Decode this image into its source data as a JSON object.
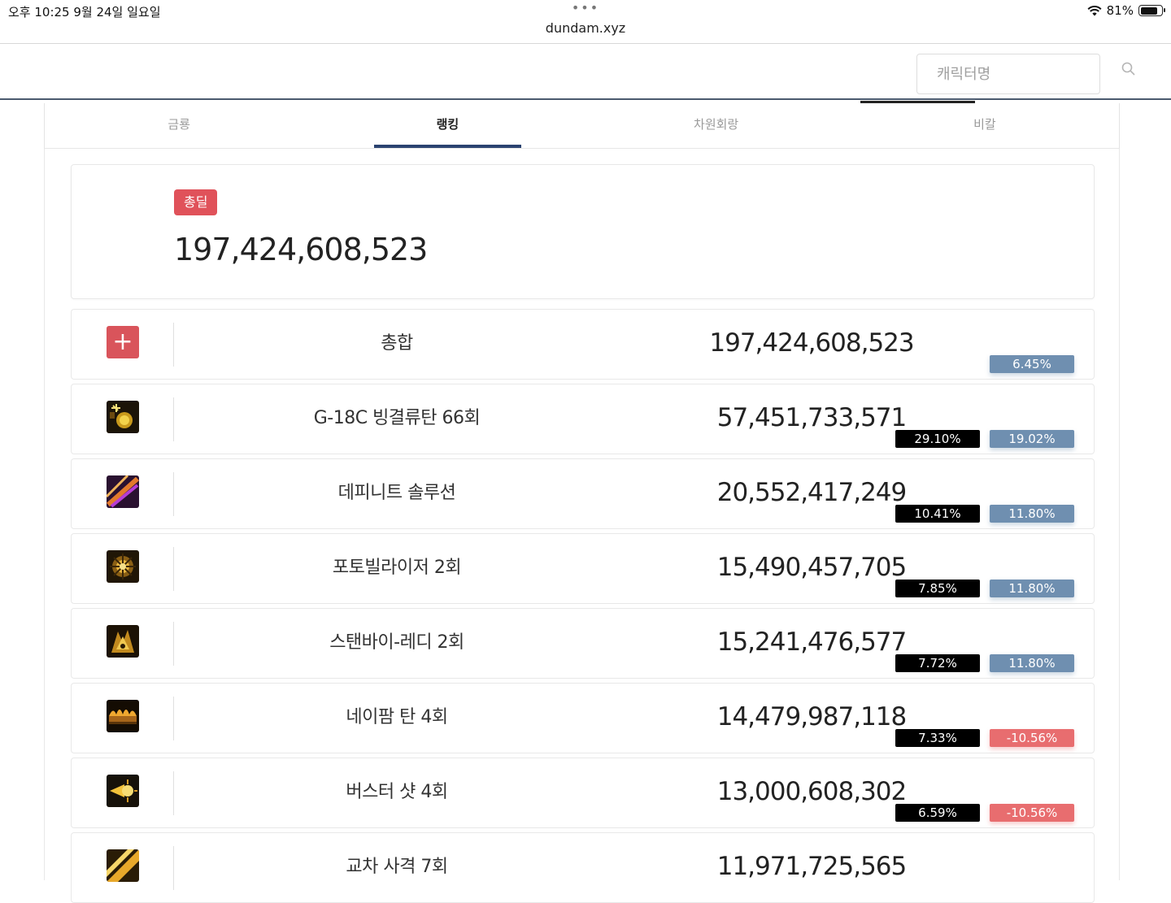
{
  "status_bar": {
    "time": "오후 10:25   9월 24일 일요일",
    "url": "dundam.xyz",
    "battery": "81%",
    "battery_level": 0.81
  },
  "header": {
    "search_placeholder": "캐릭터명"
  },
  "tabs": [
    {
      "label": "금룡",
      "active": false
    },
    {
      "label": "랭킹",
      "active": true
    },
    {
      "label": "차원회랑",
      "active": false
    },
    {
      "label": "비칼",
      "active": false
    }
  ],
  "summary": {
    "badge": "총딜",
    "value": "197,424,608,523"
  },
  "total_row": {
    "name": "총합",
    "damage": "197,424,608,523",
    "change": "6.45%"
  },
  "skills": [
    {
      "icon": "gatling-bullet-icon",
      "name": "G-18C 빙결류탄 66회",
      "damage": "57,451,733,571",
      "share": "29.10%",
      "change": "19.02%",
      "negative": false
    },
    {
      "icon": "definite-solution-icon",
      "name": "데피니트 솔루션",
      "damage": "20,552,417,249",
      "share": "10.41%",
      "change": "11.80%",
      "negative": false
    },
    {
      "icon": "photobilizer-icon",
      "name": "포토빌라이저 2회",
      "damage": "15,490,457,705",
      "share": "7.85%",
      "change": "11.80%",
      "negative": false
    },
    {
      "icon": "standby-ready-icon",
      "name": "스탠바이-레디 2회",
      "damage": "15,241,476,577",
      "share": "7.72%",
      "change": "11.80%",
      "negative": false
    },
    {
      "icon": "napalm-icon",
      "name": "네이팜 탄 4회",
      "damage": "14,479,987,118",
      "share": "7.33%",
      "change": "-10.56%",
      "negative": true
    },
    {
      "icon": "buster-shot-icon",
      "name": "버스터 샷 4회",
      "damage": "13,000,608,302",
      "share": "6.59%",
      "change": "-10.56%",
      "negative": true
    },
    {
      "icon": "crossfire-icon",
      "name": "교차 사격 7회",
      "damage": "11,971,725,565",
      "share": "",
      "change": "",
      "negative": false
    }
  ],
  "colors": {
    "accent": "#2b4370",
    "badge_red": "#e0525a",
    "positive": "#6f8fb0",
    "negative": "#e86d6f"
  }
}
